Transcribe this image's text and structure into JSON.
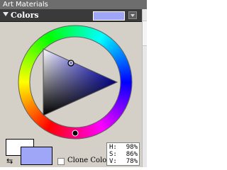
{
  "window": {
    "title": "Art Materials"
  },
  "tab": {
    "label": "Colors"
  },
  "colors": {
    "primary": "#9fa6f7",
    "secondary": "#ffffff",
    "hue_marker": "#0000ff"
  },
  "icons": {
    "tab_toggle": "triangle-down-icon",
    "menu": "triangle-down-icon",
    "swap": "swap-arrows-icon"
  },
  "controls": {
    "clone_label": "Clone Color",
    "clone_checked": false
  },
  "hsv": {
    "h_label": "H:",
    "h_value": "98%",
    "s_label": "S:",
    "s_value": "86%",
    "v_label": "V:",
    "v_value": "78%"
  }
}
